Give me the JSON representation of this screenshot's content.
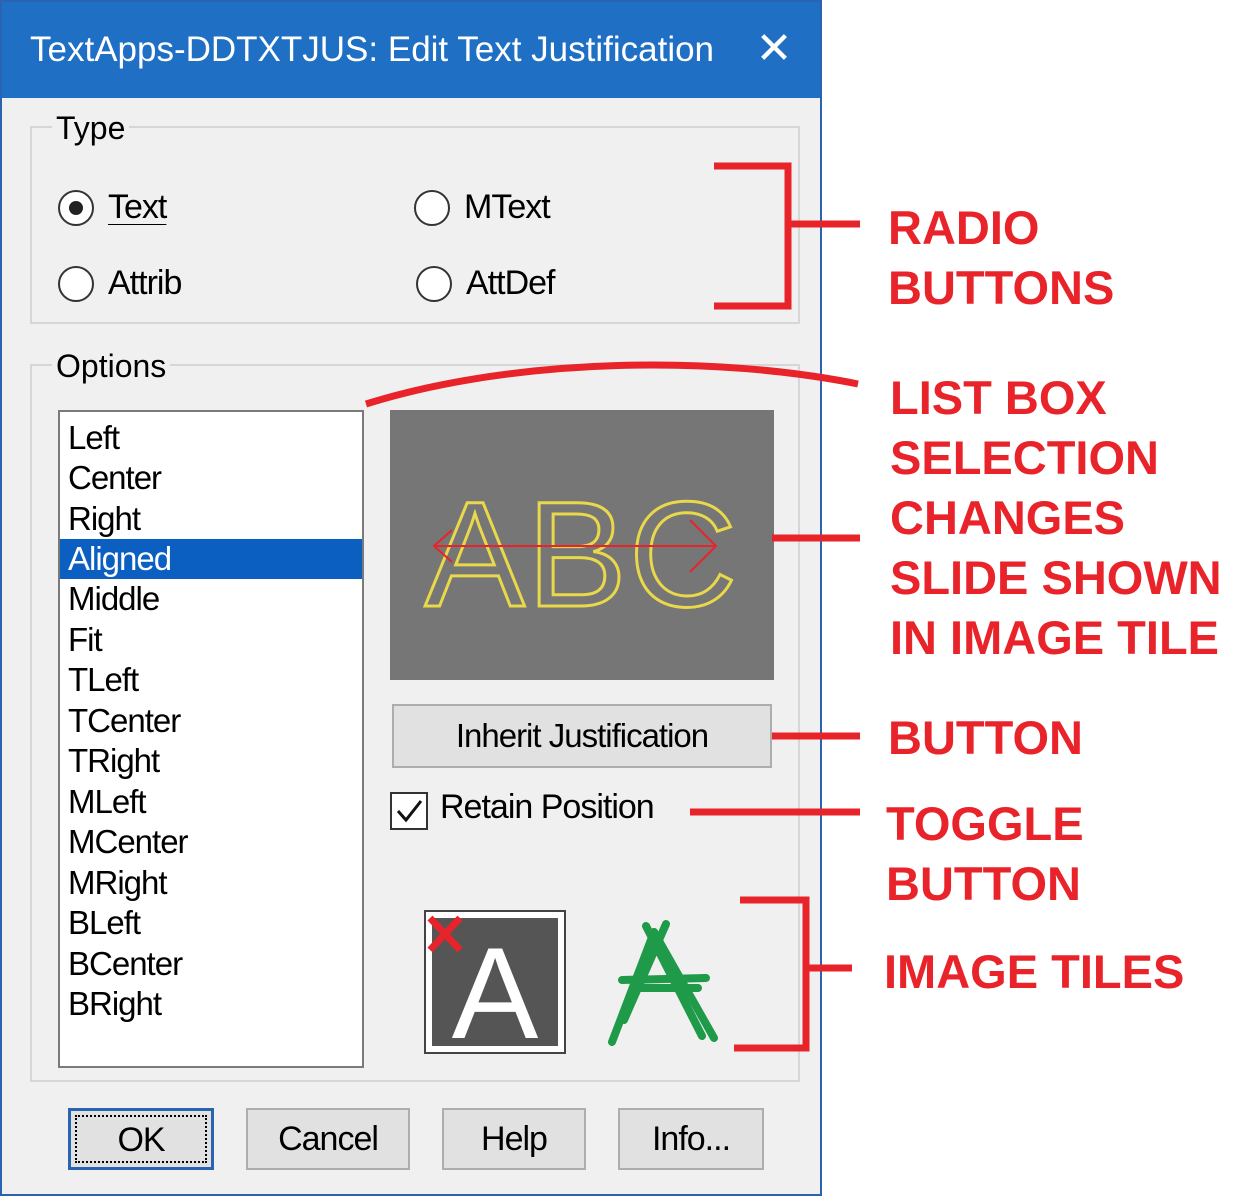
{
  "window": {
    "title": "TextApps-DDTXTJUS: Edit Text Justification",
    "close_glyph": "✕"
  },
  "type_group": {
    "label": "Type",
    "radios": [
      {
        "label": "Text",
        "checked": true
      },
      {
        "label": "MText",
        "checked": false
      },
      {
        "label": "Attrib",
        "checked": false
      },
      {
        "label": "AttDef",
        "checked": false
      }
    ]
  },
  "options_group": {
    "label": "Options",
    "list_items": [
      "Left",
      "Center",
      "Right",
      "Aligned",
      "Middle",
      "Fit",
      "TLeft",
      "TCenter",
      "TRight",
      "MLeft",
      "MCenter",
      "MRight",
      "BLeft",
      "BCenter",
      "BRight"
    ],
    "selected_item": "Aligned"
  },
  "preview": {
    "text": "ABC",
    "background_color": "#767676",
    "text_color": "#e8d84a",
    "arrow_color": "#e8232a"
  },
  "inherit_button": {
    "label": "Inherit Justification"
  },
  "retain_position": {
    "label": "Retain Position",
    "checked": true
  },
  "image_tiles": [
    {
      "icon": "letter-a-delete-icon",
      "letter": "A"
    },
    {
      "icon": "letter-a-crossed-green-icon",
      "letter": "A"
    }
  ],
  "buttons": {
    "ok": "OK",
    "cancel": "Cancel",
    "help": "Help",
    "info": "Info..."
  },
  "annotations": {
    "radio_buttons": [
      "RADIO",
      "BUTTONS"
    ],
    "list_box": [
      "LIST BOX",
      "SELECTION",
      "CHANGES",
      "SLIDE SHOWN",
      "IN IMAGE TILE"
    ],
    "button": [
      "BUTTON"
    ],
    "toggle": [
      "TOGGLE",
      "BUTTON"
    ],
    "image_tiles": [
      "IMAGE TILES"
    ],
    "color": "#e8232a"
  }
}
